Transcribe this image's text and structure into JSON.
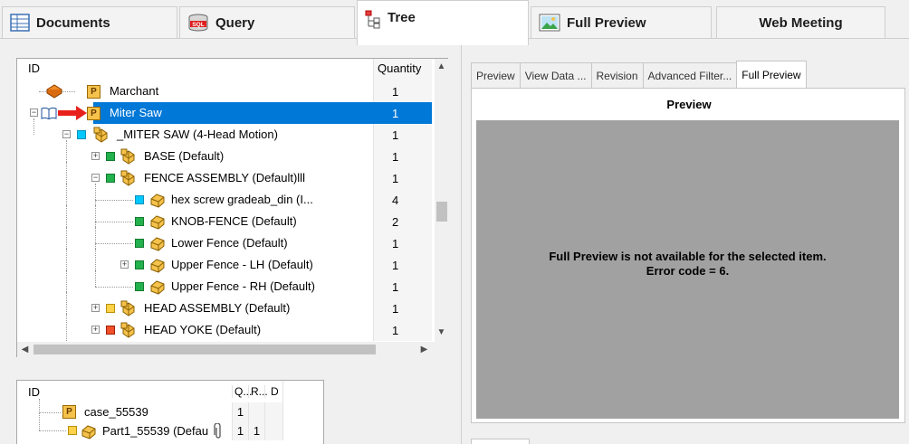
{
  "top_tabs": [
    {
      "label": "Documents",
      "icon": "documents-grid-icon"
    },
    {
      "label": "Query",
      "icon": "sql-database-icon"
    },
    {
      "label": "Tree",
      "icon": "tree-structure-icon"
    },
    {
      "label": "Full Preview",
      "icon": "image-preview-icon"
    },
    {
      "label": "Web Meeting",
      "icon": ""
    }
  ],
  "tree": {
    "header_id": "ID",
    "header_quantity": "Quantity",
    "rows": [
      {
        "label": "Marchant",
        "qty": "1"
      },
      {
        "label": "Miter Saw",
        "qty": "1"
      },
      {
        "label": "_MITER SAW (4-Head Motion)",
        "qty": "1"
      },
      {
        "label": "BASE (Default)",
        "qty": "1"
      },
      {
        "label": "FENCE ASSEMBLY (Default)lll",
        "qty": "1"
      },
      {
        "label": "hex screw gradeab_din (I...",
        "qty": "4"
      },
      {
        "label": "KNOB-FENCE (Default)",
        "qty": "2"
      },
      {
        "label": "Lower Fence (Default)",
        "qty": "1"
      },
      {
        "label": "Upper Fence - LH (Default)",
        "qty": "1"
      },
      {
        "label": "Upper Fence - RH (Default)",
        "qty": "1"
      },
      {
        "label": "HEAD ASSEMBLY (Default)",
        "qty": "1"
      },
      {
        "label": "HEAD YOKE (Default)",
        "qty": "1"
      }
    ],
    "p_badge": "P"
  },
  "bottom_tree": {
    "header_id": "ID",
    "header_q": "Q...",
    "header_r": "R...",
    "header_d": "D",
    "rows": [
      {
        "label": "case_55539",
        "q": "1",
        "r": ""
      },
      {
        "label": "Part1_55539 (Defau",
        "q": "1",
        "r": "1"
      }
    ]
  },
  "right": {
    "tabs": [
      "Preview",
      "View Data ...",
      "Revision",
      "Advanced Filter...",
      "Full Preview"
    ],
    "preview_title": "Preview",
    "message_line1": "Full Preview is not available for the selected item.",
    "message_line2": "Error code = 6."
  },
  "colors": {
    "selection": "#0078d7",
    "preview_bg": "#a1a1a1",
    "cyan_status": "#00c8ff",
    "green_status": "#22b14c",
    "yellow_status": "#ffd24a",
    "red_status": "#f0502a"
  }
}
